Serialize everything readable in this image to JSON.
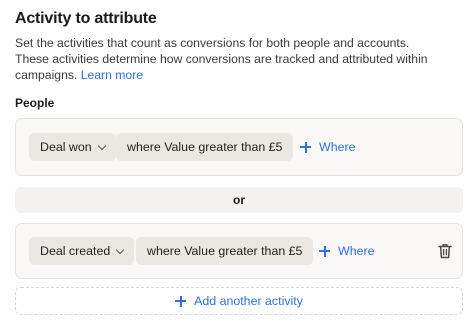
{
  "title": "Activity to attribute",
  "description": {
    "text": "Set the activities that count as conversions for both people and accounts. These activities determine how conversions are tracked and attributed within campaigns.",
    "link": "Learn more"
  },
  "section_label": "People",
  "rules": [
    {
      "activity": "Deal won",
      "condition": "where Value greater than £5",
      "where_label": "Where"
    },
    {
      "activity": "Deal created",
      "condition": "where Value greater than £5",
      "where_label": "Where"
    }
  ],
  "separator": "or",
  "add_activity_label": "Add another activity",
  "colors": {
    "accent": "#2f6fe0",
    "card_bg": "#f9f8f6",
    "chip_bg": "#ebe8e4"
  },
  "icons": {
    "chevron": "chevron-down-icon",
    "plus": "plus-icon",
    "delete": "trash-icon"
  }
}
